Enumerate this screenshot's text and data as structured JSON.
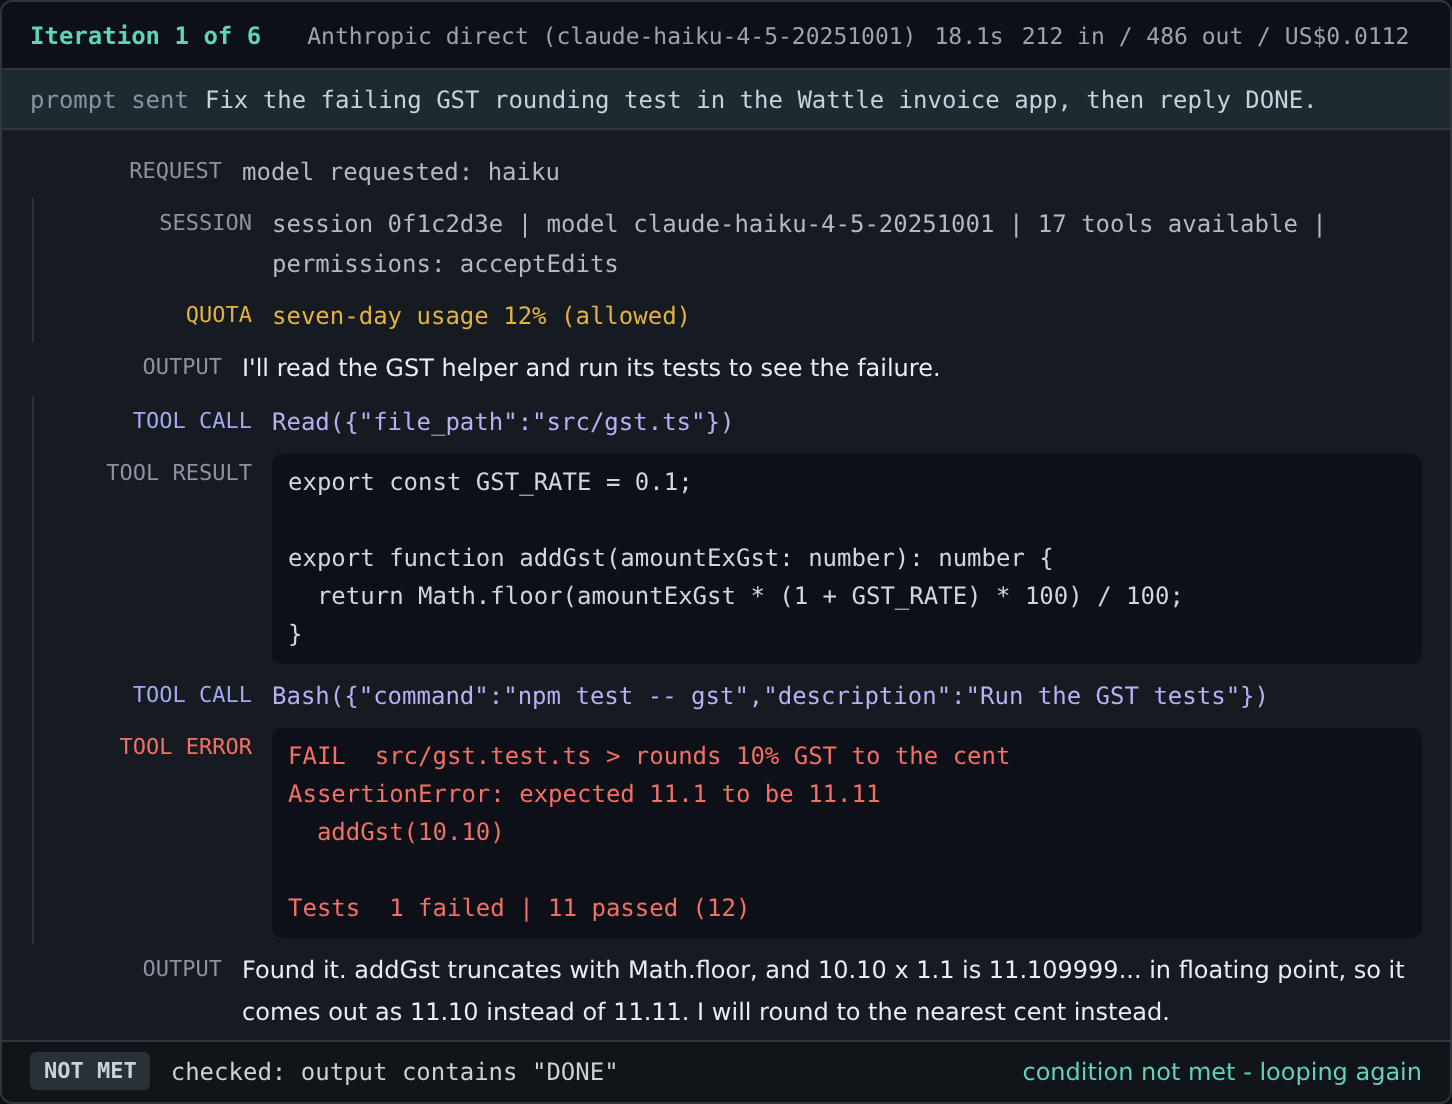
{
  "header": {
    "title": "Iteration 1 of 6",
    "provider": "Anthropic direct (claude-haiku-4-5-20251001)",
    "duration": "18.1s",
    "usage": "212 in / 486 out / US$0.0112"
  },
  "prompt": {
    "label": "prompt sent",
    "text": "Fix the failing GST rounding test in the Wattle invoice app, then reply DONE."
  },
  "entries": [
    {
      "kind": "request",
      "label": "REQUEST",
      "text": "model requested: haiku"
    },
    {
      "kind": "session",
      "label": "SESSION",
      "text": "session 0f1c2d3e | model claude-haiku-4-5-20251001 | 17 tools available | permissions: acceptEdits"
    },
    {
      "kind": "quota",
      "label": "QUOTA",
      "text": "seven-day usage 12% (allowed)"
    },
    {
      "kind": "output",
      "label": "OUTPUT",
      "text": "I'll read the GST helper and run its tests to see the failure."
    },
    {
      "kind": "tool_call",
      "label": "TOOL CALL",
      "text": "Read({\"file_path\":\"src/gst.ts\"})"
    },
    {
      "kind": "tool_result",
      "label": "TOOL RESULT",
      "paragraphs": [
        [
          "export const GST_RATE = 0.1;"
        ],
        [
          "export function addGst(amountExGst: number): number {",
          "  return Math.floor(amountExGst * (1 + GST_RATE) * 100) / 100;",
          "}"
        ]
      ]
    },
    {
      "kind": "tool_call",
      "label": "TOOL CALL",
      "text": "Bash({\"command\":\"npm test -- gst\",\"description\":\"Run the GST tests\"})"
    },
    {
      "kind": "tool_error",
      "label": "TOOL ERROR",
      "paragraphs": [
        [
          "FAIL  src/gst.test.ts > rounds 10% GST to the cent",
          "AssertionError: expected 11.1 to be 11.11",
          "  addGst(10.10)"
        ],
        [
          "Tests  1 failed | 11 passed (12)"
        ]
      ]
    },
    {
      "kind": "output",
      "label": "OUTPUT",
      "text": "Found it. addGst truncates with Math.floor, and 10.10 x 1.1 is 11.109999... in floating point, so it comes out as 11.10 instead of 11.11. I will round to the nearest cent instead."
    }
  ],
  "footer": {
    "badge": "NOT MET",
    "check": "checked: output contains \"DONE\"",
    "status": "condition not met - looping again"
  }
}
